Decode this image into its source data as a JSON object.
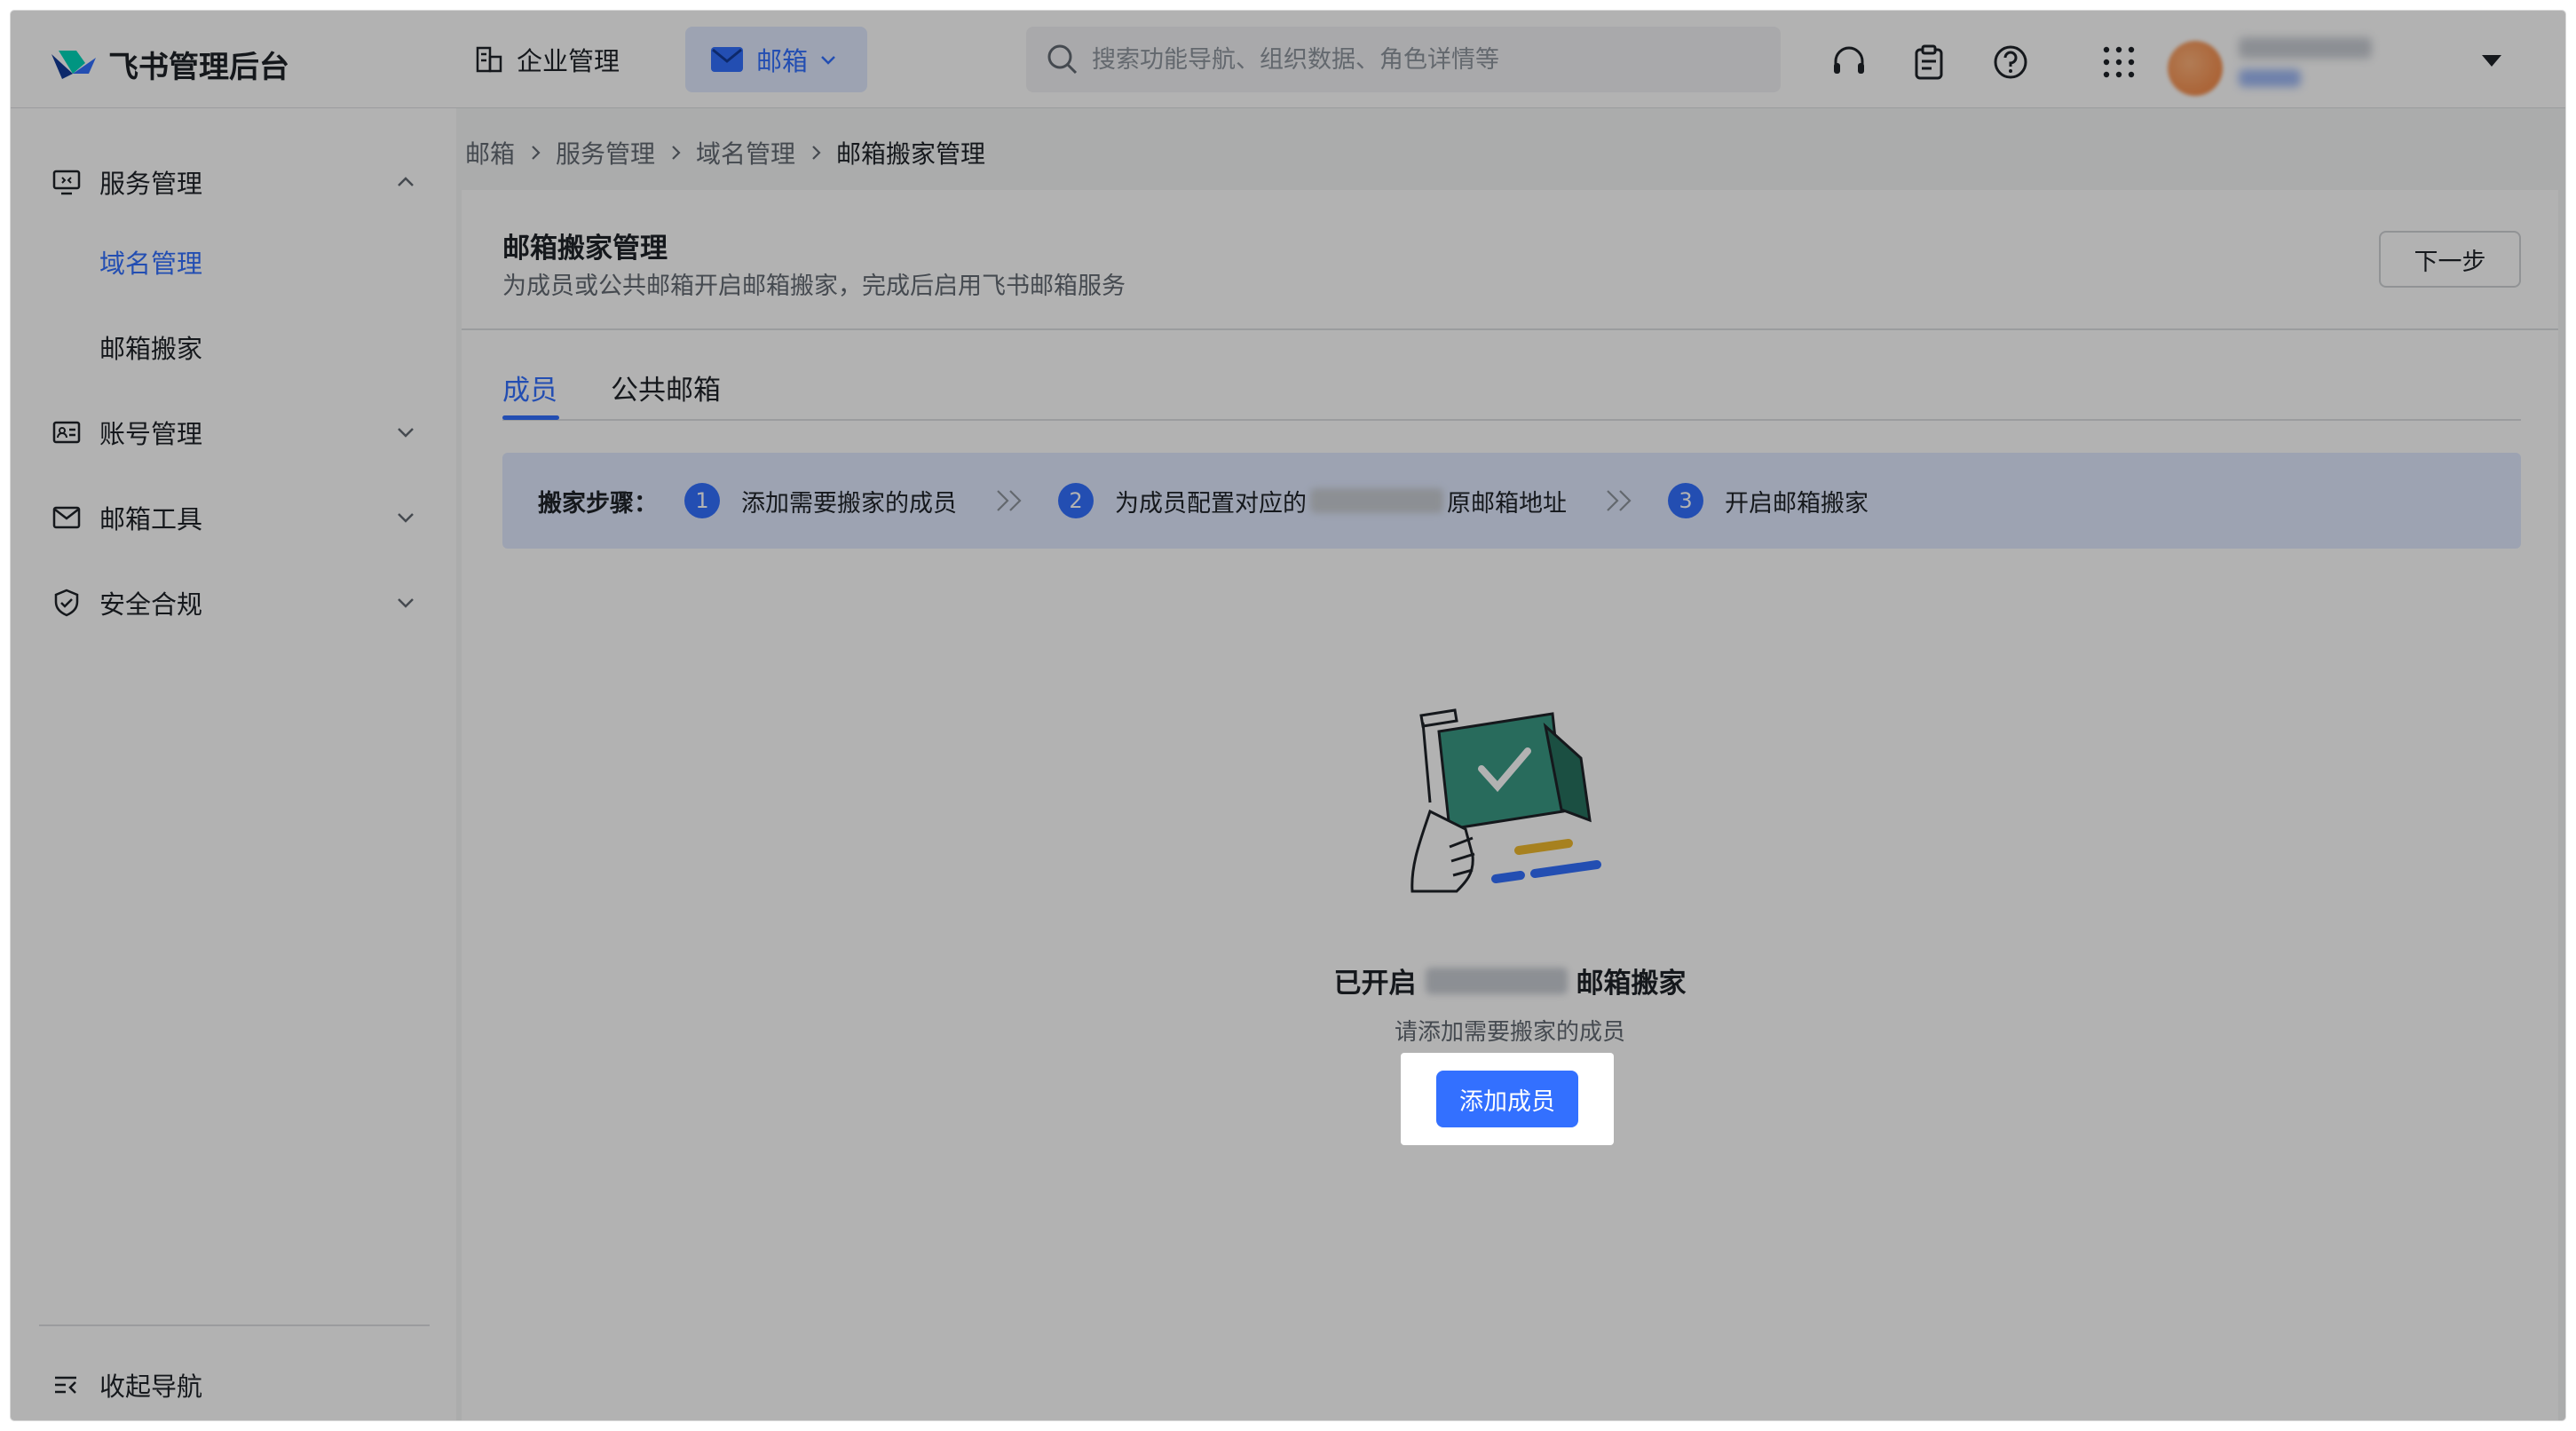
{
  "app": {
    "name": "飞书管理后台"
  },
  "topbar": {
    "enterprise_label": "企业管理",
    "mail_label": "邮箱",
    "search_placeholder": "搜索功能导航、组织数据、角色详情等",
    "icons": [
      "headset-icon",
      "clipboard-icon",
      "help-icon",
      "apps-grid-icon"
    ]
  },
  "sidebar": {
    "items": [
      {
        "label": "服务管理",
        "icon": "monitor-icon",
        "expanded": true,
        "children": [
          {
            "label": "域名管理",
            "active": true
          },
          {
            "label": "邮箱搬家",
            "active": false
          }
        ]
      },
      {
        "label": "账号管理",
        "icon": "id-card-icon",
        "expanded": false
      },
      {
        "label": "邮箱工具",
        "icon": "mail-icon",
        "expanded": false
      },
      {
        "label": "安全合规",
        "icon": "shield-check-icon",
        "expanded": false
      }
    ],
    "collapse_label": "收起导航"
  },
  "breadcrumb": [
    "邮箱",
    "服务管理",
    "域名管理",
    "邮箱搬家管理"
  ],
  "page": {
    "title": "邮箱搬家管理",
    "subtitle": "为成员或公共邮箱开启邮箱搬家，完成后启用飞书邮箱服务",
    "next_button": "下一步",
    "tabs": [
      "成员",
      "公共邮箱"
    ],
    "active_tab": 0
  },
  "steps": {
    "lead": "搬家步骤：",
    "items": [
      {
        "num": "1",
        "text": "添加需要搬家的成员"
      },
      {
        "num": "2",
        "text_before": "为成员配置对应的",
        "text_after": "原邮箱地址"
      },
      {
        "num": "3",
        "text": "开启邮箱搬家"
      }
    ]
  },
  "empty_state": {
    "title_before": "已开启",
    "title_after": "邮箱搬家",
    "subtitle": "请添加需要搬家的成员",
    "button": "添加成员"
  },
  "colors": {
    "accent": "#3370ff",
    "accent_light": "#e1eaff",
    "illustration_green": "#3a9a85",
    "illustration_yellow": "#f0b92d"
  }
}
